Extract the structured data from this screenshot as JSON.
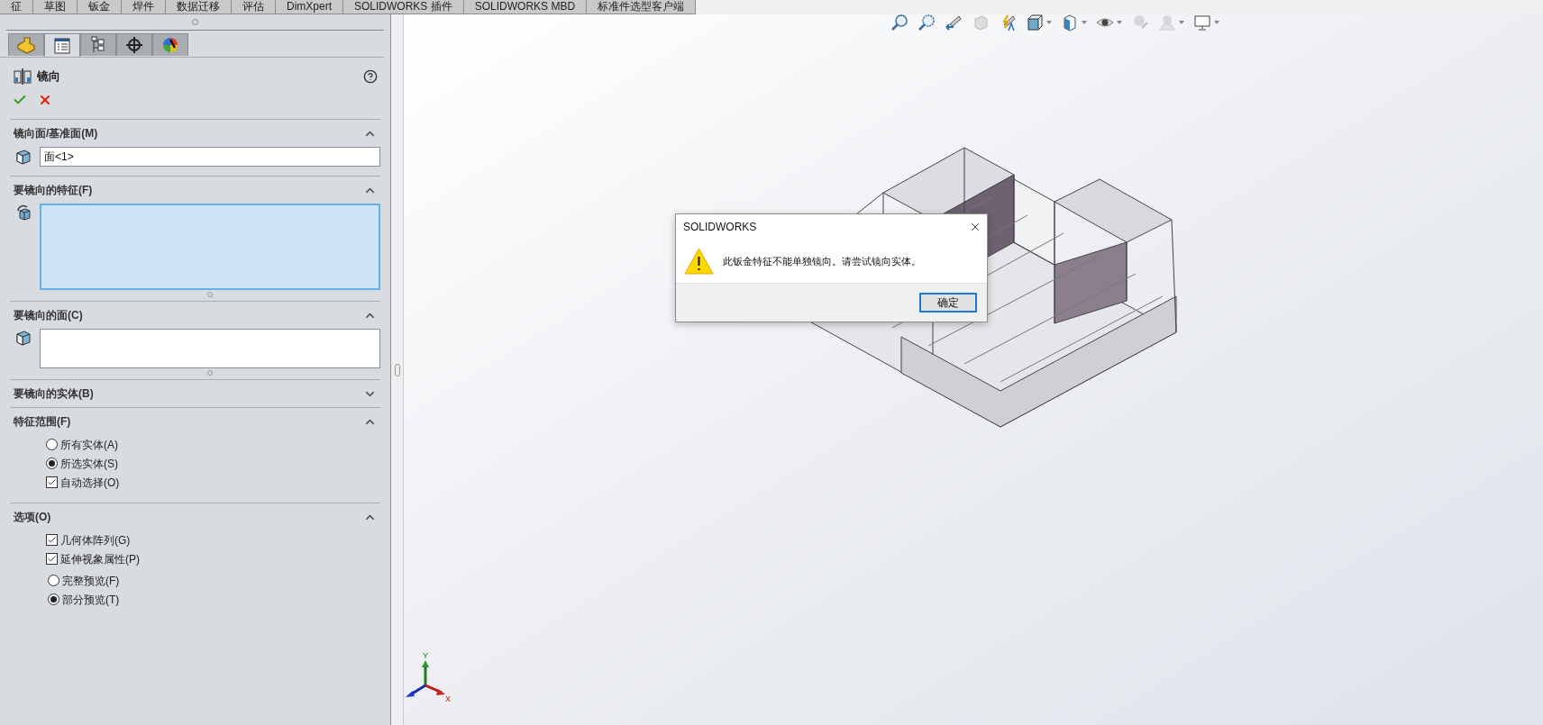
{
  "command_tabs": [
    {
      "label": "征"
    },
    {
      "label": "草图"
    },
    {
      "label": "钣金"
    },
    {
      "label": "焊件"
    },
    {
      "label": "数据迁移"
    },
    {
      "label": "评估"
    },
    {
      "label": "DimXpert"
    },
    {
      "label": "SOLIDWORKS 插件"
    },
    {
      "label": "SOLIDWORKS MBD"
    },
    {
      "label": "标准件选型客户端"
    }
  ],
  "panel_tabs": [
    {
      "selected": false
    },
    {
      "selected": true
    },
    {
      "selected": false
    },
    {
      "selected": false
    },
    {
      "selected": false
    }
  ],
  "property_manager": {
    "title": "镜向",
    "sections": [
      {
        "kind": "field",
        "title": "镜向面/基准面(M)",
        "expanded": true,
        "value": "面<1>"
      },
      {
        "kind": "list",
        "title": "要镜向的特征(F)",
        "expanded": true,
        "active": true
      },
      {
        "kind": "list",
        "title": "要镜向的面(C)",
        "expanded": true,
        "active": false
      },
      {
        "kind": "list",
        "title": "要镜向的实体(B)",
        "expanded": false
      },
      {
        "kind": "options",
        "title": "特征范围(F)",
        "expanded": true,
        "options": [
          {
            "kind": "radio",
            "label": "所有实体(A)",
            "checked": false
          },
          {
            "kind": "radio",
            "label": "所选实体(S)",
            "checked": true
          },
          {
            "kind": "checkbox",
            "label": "自动选择(O)",
            "checked": true
          }
        ]
      },
      {
        "kind": "options",
        "title": "选项(O)",
        "expanded": true,
        "options": [
          {
            "kind": "checkbox",
            "label": "几何体阵列(G)",
            "checked": true
          },
          {
            "kind": "checkbox",
            "label": "延伸视象属性(P)",
            "checked": true
          },
          {
            "kind": "radio",
            "label": "完整预览(F)",
            "checked": false
          },
          {
            "kind": "radio",
            "label": "部分预览(T)",
            "checked": true
          }
        ]
      }
    ]
  },
  "dialog": {
    "title": "SOLIDWORKS",
    "message": "此钣金特征不能单独镜向。请尝试镜向实体。",
    "button": "确定"
  },
  "axes": {
    "x": "X",
    "y": "Y"
  }
}
